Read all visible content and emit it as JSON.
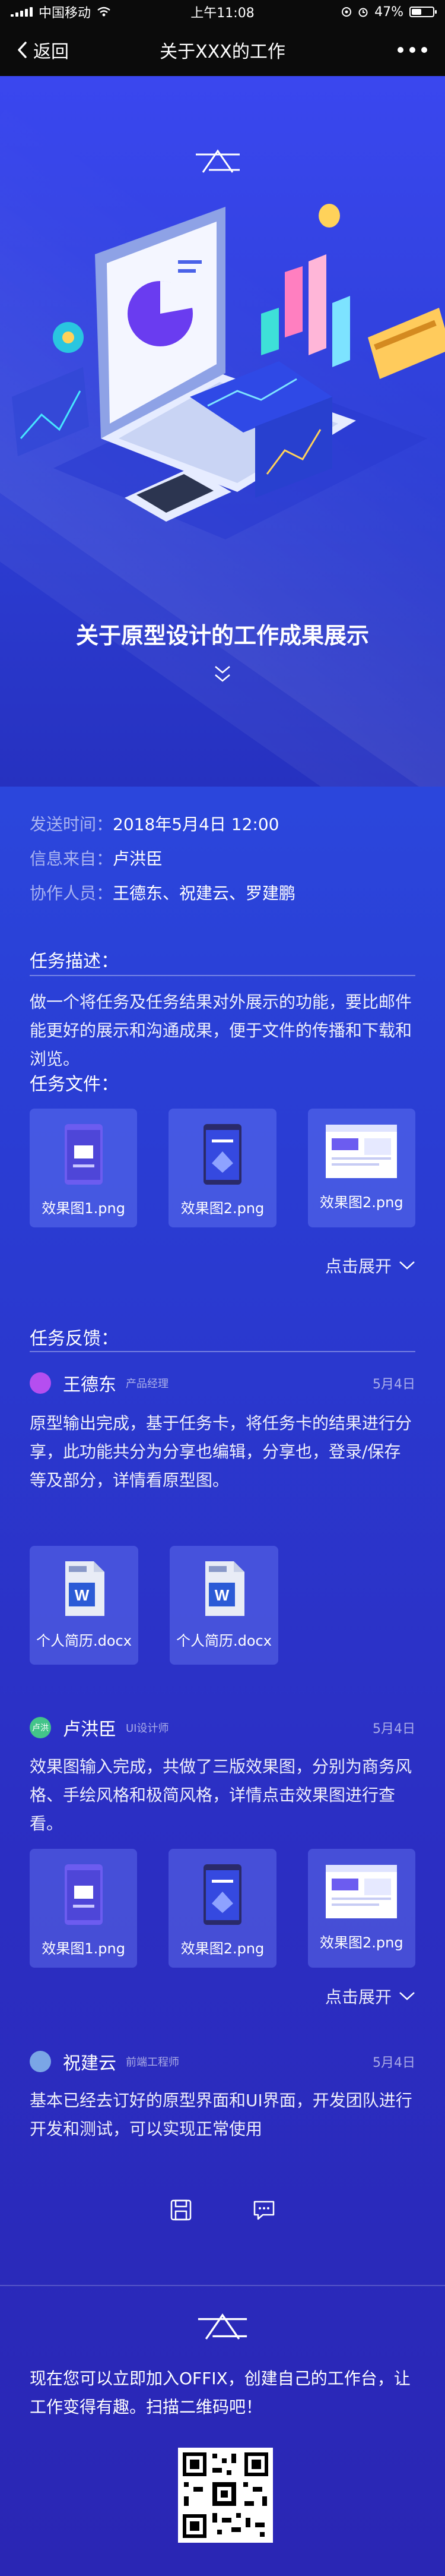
{
  "status_bar": {
    "carrier": "中国移动",
    "time": "上午11:08",
    "battery_text": "47%",
    "battery_level": 0.47
  },
  "nav": {
    "back_label": "返回",
    "title": "关于XXX的工作"
  },
  "hero": {
    "title": "关于原型设计的工作成果展示"
  },
  "meta": {
    "rows": [
      {
        "key": "发送时间：",
        "value": "2018年5月4日 12:00"
      },
      {
        "key": "信息来自：",
        "value": "卢洪臣"
      },
      {
        "key": "协作人员：",
        "value": "王德东、祝建云、罗建鹏"
      }
    ]
  },
  "task_desc": {
    "title": "任务描述：",
    "text": "做一个将任务及任务结果对外展示的功能，要比邮件能更好的展示和沟通成果，便于文件的传播和下载和浏览。"
  },
  "task_files": {
    "title": "任务文件：",
    "files": [
      {
        "name": "效果图1.png"
      },
      {
        "name": "效果图2.png"
      },
      {
        "name": "效果图2.png"
      }
    ],
    "expand_label": "点击展开"
  },
  "feedback": {
    "title": "任务反馈：",
    "items": [
      {
        "name": "王德东",
        "role": "产品经理",
        "date": "5月4日",
        "avatar_color": "#b54ef0",
        "text": "原型输出完成，基于任务卡，将任务卡的结果进行分享，此功能共分为分享也编辑，分享也，登录/保存等及部分，详情看原型图。",
        "docs": [
          {
            "name": "个人简历.docx"
          },
          {
            "name": "个人简历.docx"
          }
        ]
      },
      {
        "name": "卢洪臣",
        "role": "UI设计师",
        "date": "5月4日",
        "avatar_color": "#43c48a",
        "avatar_text": "卢洪",
        "text": "效果图输入完成，共做了三版效果图，分别为商务风格、手绘风格和极简风格，详情点击效果图进行查看。",
        "files": [
          {
            "name": "效果图1.png"
          },
          {
            "name": "效果图2.png"
          },
          {
            "name": "效果图2.png"
          }
        ],
        "expand_label": "点击展开"
      },
      {
        "name": "祝建云",
        "role": "前端工程师",
        "date": "5月4日",
        "avatar_color": "#7aa6e6",
        "text": "基本已经去订好的原型界面和UI界面，开发团队进行开发和测试，可以实现正常使用"
      }
    ]
  },
  "footer": {
    "text": "现在您可以立即加入OFFIX，创建自己的工作台，让工作变得有趣。扫描二维码吧！"
  }
}
